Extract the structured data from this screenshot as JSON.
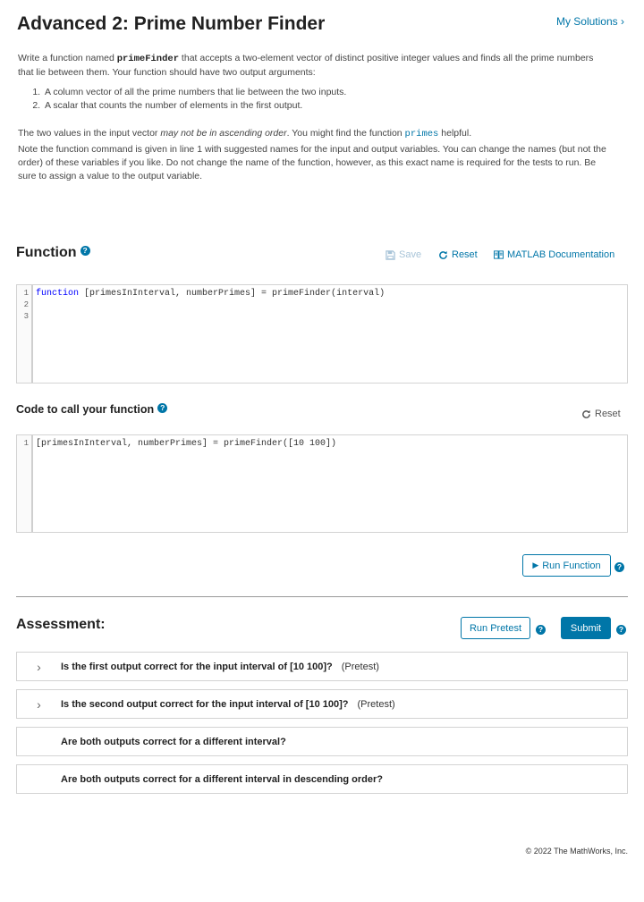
{
  "header": {
    "title": "Advanced 2: Prime Number Finder",
    "my_solutions": "My Solutions"
  },
  "description": {
    "p1_before": "Write a function named ",
    "p1_func": "primeFinder",
    "p1_after": " that accepts a two-element vector of distinct positive integer values and finds all the prime numbers that lie between them. Your function should have two output arguments:",
    "list": [
      "A column vector of all the prime numbers that lie between the two inputs.",
      "A scalar that counts the number of elements in the first output."
    ],
    "p2_before": "The two values in the input vector ",
    "p2_em": "may not be in ascending order",
    "p2_mid": ". You might find the function ",
    "p2_code": "primes",
    "p2_after": " helpful.",
    "p3": "Note the function command is given in line 1 with suggested names for the input and output variables.  You can change the names (but not the order) of these variables if you like.  Do not change the name of the function, however, as this exact name is required for the tests to run.  Be sure to assign a value to the output variable."
  },
  "function_section": {
    "title": "Function",
    "save": "Save",
    "reset": "Reset",
    "docs": "MATLAB Documentation",
    "line_numbers": [
      "1",
      "2",
      "3"
    ],
    "code_keyword": "function",
    "code_rest": " [primesInInterval, numberPrimes] = primeFinder(interval)"
  },
  "call_section": {
    "title": "Code to call your function",
    "reset": "Reset",
    "line_numbers": [
      "1"
    ],
    "code": "[primesInInterval, numberPrimes] = primeFinder([10 100])",
    "run_function": "Run Function"
  },
  "assessment": {
    "title": "Assessment:",
    "run_pretest": "Run Pretest",
    "submit": "Submit",
    "tests": [
      {
        "question": "Is the first output correct for the input interval of [10 100]?",
        "tag": "(Pretest)"
      },
      {
        "question": "Is the second output correct for the input interval of [10 100]?",
        "tag": "(Pretest)"
      },
      {
        "question": "Are both outputs correct for a different interval?",
        "tag": ""
      },
      {
        "question": "Are both outputs correct for a different interval in descending order?",
        "tag": ""
      }
    ]
  },
  "footer": {
    "copyright": "© 2022 The MathWorks, Inc."
  },
  "colors": {
    "accent": "#0076a8",
    "keyword": "#0000ff"
  }
}
